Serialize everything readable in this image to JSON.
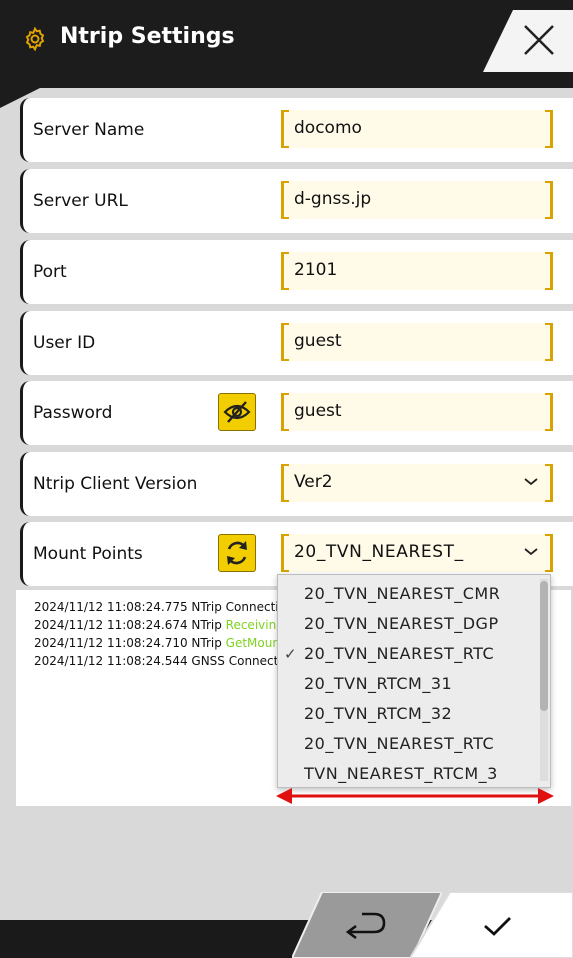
{
  "header": {
    "title": "Ntrip Settings"
  },
  "rows": [
    {
      "label": "Server Name",
      "value": "docomo"
    },
    {
      "label": "Server URL",
      "value": "d-gnss.jp"
    },
    {
      "label": "Port",
      "value": "2101"
    },
    {
      "label": "User ID",
      "value": "guest"
    },
    {
      "label": "Password",
      "value": "guest"
    },
    {
      "label": "Ntrip Client Version",
      "value": "Ver2"
    },
    {
      "label": "Mount Points",
      "value": "20_TVN_NEAREST_"
    }
  ],
  "log": [
    {
      "prefix": "2024/11/12 11:08:24.775 NTrip ",
      "highlight": "",
      "rest": "Connecti"
    },
    {
      "prefix": "2024/11/12 11:08:24.674 NTrip ",
      "highlight": "Receiving",
      "rest": ""
    },
    {
      "prefix": "2024/11/12 11:08:24.710 NTrip ",
      "highlight": "GetMoun",
      "rest": ""
    },
    {
      "prefix": "2024/11/12 11:08:24.544 GNSS ",
      "highlight": "",
      "rest": "Connecti"
    }
  ],
  "dropdown": {
    "options": [
      "20_TVN_NEAREST_CMR",
      "20_TVN_NEAREST_DGP",
      "20_TVN_NEAREST_RTC",
      "20_TVN_RTCM_31",
      "20_TVN_RTCM_32",
      "20_TVN_NEAREST_RTC",
      "TVN_NEAREST_RTCM_3"
    ],
    "checked_index": 2
  },
  "colors": {
    "accent": "#f2cd00",
    "header_bg": "#1c1c1c",
    "log_highlight": "#7ed321"
  },
  "icons": {
    "settings": "gear-icon",
    "close": "close-icon",
    "visibility": "eye-off-icon",
    "refresh": "refresh-icon",
    "back": "return-icon",
    "confirm": "check-icon"
  }
}
